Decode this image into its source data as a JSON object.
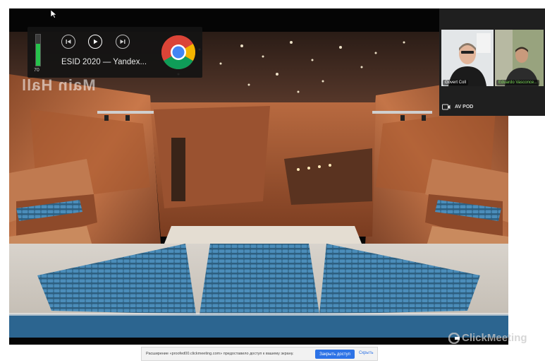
{
  "scene": {
    "wall_text": "Main Hall"
  },
  "media_player": {
    "volume_level": 0.7,
    "volume_value": "70",
    "title": "ESID 2020 — Yandex...",
    "icons": {
      "previous": "previous-track-icon",
      "play": "play-icon",
      "next": "next-track-icon",
      "browser": "chrome-logo-icon"
    }
  },
  "participants": [
    {
      "name": "Govert Coll"
    },
    {
      "name": "Eduardo Vasconce..."
    }
  ],
  "av_panel": {
    "label": "AV POD",
    "icon": "video-camera-icon"
  },
  "share_bar": {
    "message": "Расширение «proofed00.clickmeeting.com» предоставило доступ к вашему экрану.",
    "share_button": "Закрыть доступ",
    "hide_link": "Скрыть"
  },
  "watermark": {
    "text": "ClickMeeting"
  },
  "colors": {
    "seat_blue": "#3c7ea8",
    "wood": "#b4643a",
    "accent_green": "#27c24c",
    "link_blue": "#2d73e6"
  }
}
